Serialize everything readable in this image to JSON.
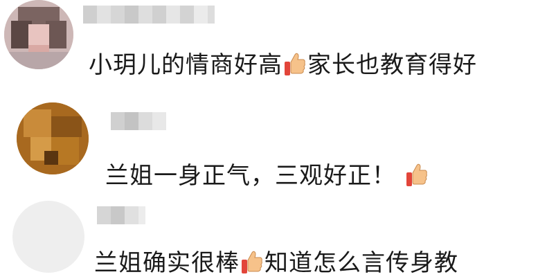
{
  "comments": [
    {
      "before_emoji": "小玥儿的情商好高",
      "emoji": "thumbs-up-emoji",
      "after_emoji": "家长也教育得好"
    },
    {
      "before_emoji": "兰姐一身正气，三观好正！",
      "emoji": "thumbs-up-emoji",
      "after_emoji": ""
    },
    {
      "before_emoji": "兰姐确实很棒",
      "emoji": "thumbs-up-emoji",
      "after_emoji": "知道怎么言传身教"
    }
  ],
  "colors": {
    "text": "#1a1a1a",
    "thumb_skin": "#f6c28a",
    "thumb_cuff": "#e2453a"
  }
}
